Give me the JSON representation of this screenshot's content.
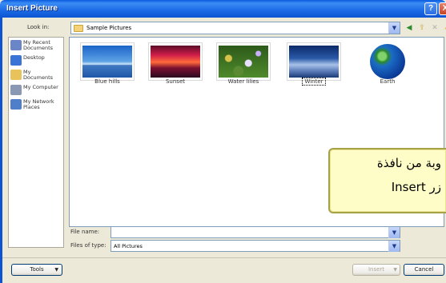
{
  "window": {
    "title": "Insert Picture",
    "help_icon": "?",
    "close_icon": "X"
  },
  "lookin": {
    "label": "Look in:",
    "value": "Sample Pictures"
  },
  "places": [
    {
      "label": "My Recent Documents",
      "icon": "recent-docs-icon",
      "color": "#6b86c6"
    },
    {
      "label": "Desktop",
      "icon": "desktop-icon",
      "color": "#3a74d6"
    },
    {
      "label": "My Documents",
      "icon": "my-documents-icon",
      "color": "#e8c25a"
    },
    {
      "label": "My Computer",
      "icon": "my-computer-icon",
      "color": "#8a98b4"
    },
    {
      "label": "My Network Places",
      "icon": "network-places-icon",
      "color": "#4f7fc9"
    }
  ],
  "files": [
    {
      "name": "Blue hills",
      "thumb": "blue-hills"
    },
    {
      "name": "Sunset",
      "thumb": "sunset"
    },
    {
      "name": "Water lilies",
      "thumb": "water-lilies"
    },
    {
      "name": "Winter",
      "thumb": "winter",
      "selected": true
    },
    {
      "name": "Earth",
      "thumb": "earth"
    }
  ],
  "callout": {
    "line1": "وبة من نافذة",
    "line2": "زر Insert"
  },
  "filename": {
    "label": "File name:",
    "value": ""
  },
  "filetype": {
    "label": "Files of type:",
    "value": "All Pictures"
  },
  "buttons": {
    "tools": "Tools",
    "insert": "Insert",
    "cancel": "Cancel"
  }
}
